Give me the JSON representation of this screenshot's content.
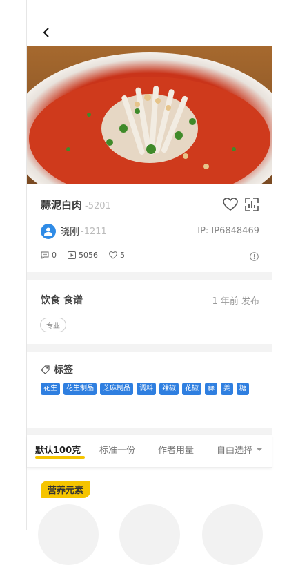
{
  "recipe": {
    "title": "蒜泥白肉",
    "title_id": "-5201",
    "author": "晓刚",
    "author_id": "-1211",
    "ip": "IP: IP6848469",
    "stats": {
      "comments": "0",
      "plays": "5056",
      "likes": "5"
    }
  },
  "category": {
    "label": "饮食 食谱",
    "time": "1 年前 发布",
    "pill": "专业"
  },
  "tags": {
    "heading": "标签",
    "items": [
      "花生",
      "花生制品",
      "芝麻制品",
      "调料",
      "辣椒",
      "花椒",
      "蒜",
      "姜",
      "糖"
    ]
  },
  "tabs": {
    "items": [
      "默认100克",
      "标准一份",
      "作者用量",
      "自由选择"
    ]
  },
  "nutrition": {
    "badge": "营养元素"
  },
  "colors": {
    "accent_yellow": "#f5c400",
    "tag_blue": "#2f7fe0",
    "avatar_blue": "#2f8be6"
  },
  "icons": [
    "back-arrow-icon",
    "heart-icon",
    "chart-icon",
    "comment-icon",
    "play-icon",
    "like-icon",
    "info-icon",
    "tag-icon",
    "user-icon",
    "dropdown-caret-icon"
  ]
}
